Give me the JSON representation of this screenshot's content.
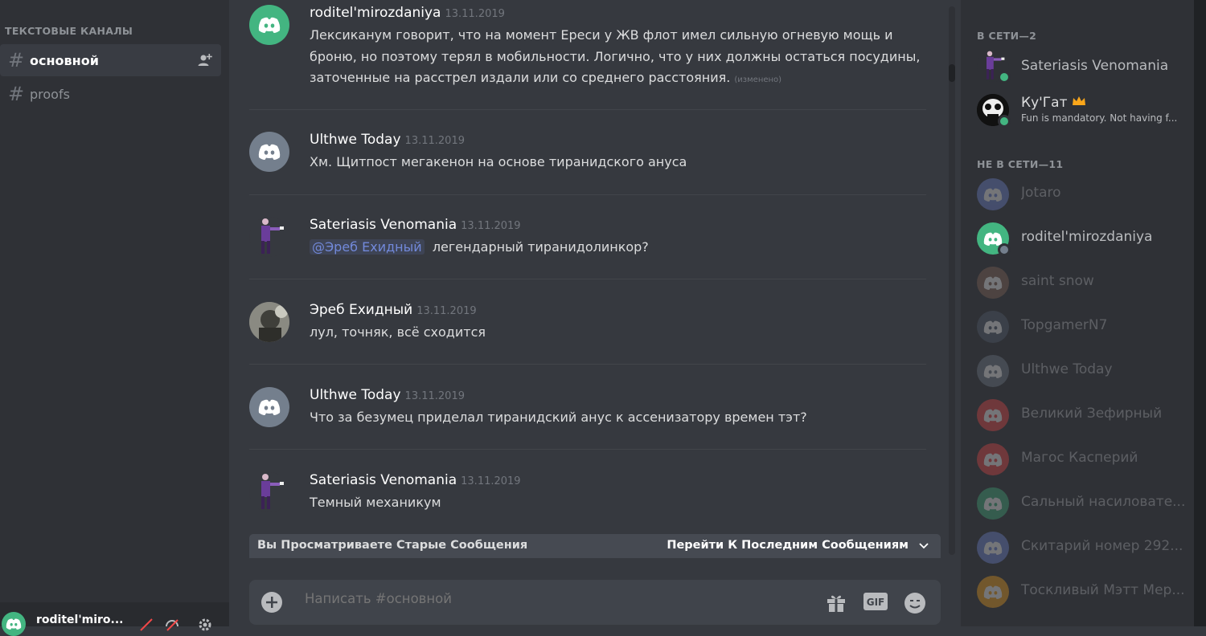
{
  "sidebar": {
    "category": "ТЕКСТОВЫЕ КАНАЛЫ",
    "channels": [
      {
        "hash": "#",
        "name": "основной"
      },
      {
        "hash": "#",
        "name": "proofs"
      }
    ],
    "user": {
      "name": "roditel'miro..."
    }
  },
  "messages": [
    {
      "author": "roditel'mirozdaniya",
      "time": "13.11.2019",
      "text": "Лексиканум говорит, что на момент Ереси у ЖВ флот имел сильную огневую мощь и броню, но поэтому терял в мобильности. Логично, что у них должны остаться посудины, заточенные на расстрел издали или со среднего расстояния.",
      "edited": "(изменено)"
    },
    {
      "author": "Ulthwe Today",
      "time": "13.11.2019",
      "text": "Хм. Щитпост мегакенон на основе тиранидского ануса"
    },
    {
      "author": "Sateriasis Venomania",
      "time": "13.11.2019",
      "mention": "@Эреб Ехидный",
      "text": "легендарный тиранидолинкор?"
    },
    {
      "author": "Эреб Ехидный",
      "time": "13.11.2019",
      "text": "лул, точняк, всё сходится"
    },
    {
      "author": "Ulthwe Today",
      "time": "13.11.2019",
      "text": "Что за безумец приделал тиранидский анус к ассенизатору времен тэт?"
    },
    {
      "author": "Sateriasis Venomania",
      "time": "13.11.2019",
      "text": "Темный механикум"
    }
  ],
  "jumpbar": {
    "left": "Вы Просматриваете Старые Сообщения",
    "right": "Перейти К Последним Сообщениям"
  },
  "composer": {
    "placeholder": "Написать #основной"
  },
  "members": {
    "online_header": "В СЕТИ—2",
    "online": [
      {
        "name": "Sateriasis Venomania"
      },
      {
        "name": "Ку'Гат",
        "activity": "Fun is mandatory. Not having f..."
      }
    ],
    "offline_header": "НЕ В СЕТИ—11",
    "offline": [
      {
        "name": "Jotaro",
        "color": "#7289da"
      },
      {
        "name": "roditel'mirozdaniya",
        "color": "#43b581"
      },
      {
        "name": "saint snow",
        "color": "#8a6a5a"
      },
      {
        "name": "TopgamerN7",
        "color": "#556070"
      },
      {
        "name": "Ulthwe Today",
        "color": "#747f8d"
      },
      {
        "name": "Великий Зефирный",
        "color": "#f04747"
      },
      {
        "name": "Магос Касперий",
        "color": "#f04747"
      },
      {
        "name": "Сальный насиловате...",
        "color": "#43b581"
      },
      {
        "name": "Скитарий номер 292...",
        "color": "#7289da"
      },
      {
        "name": "Тоскливый Мэтт Мер...",
        "color": "#faa61a"
      }
    ]
  },
  "colors": {
    "online": "#43b581",
    "crown": "#faa61a",
    "mention": "#7289da"
  }
}
